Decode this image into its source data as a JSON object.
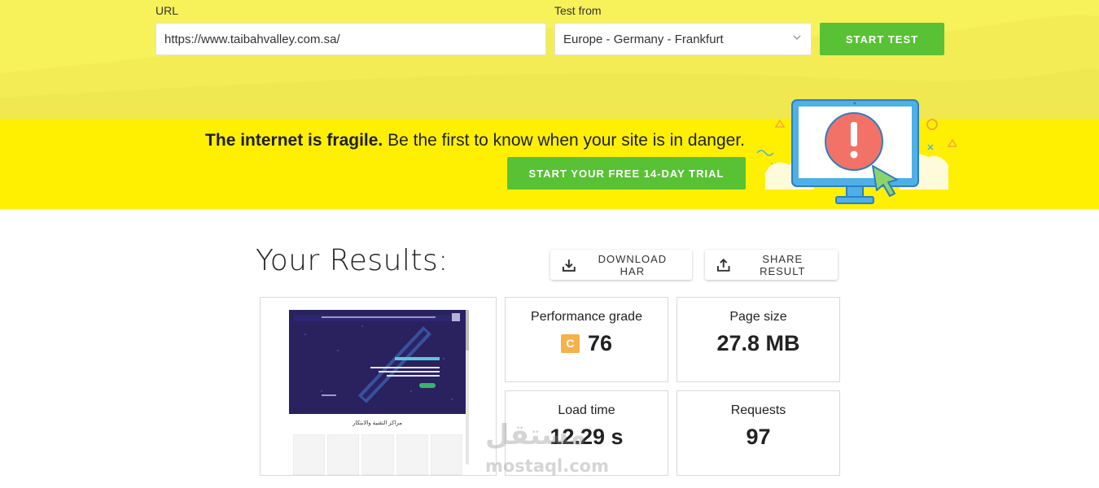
{
  "form": {
    "url_label": "URL",
    "url_value": "https://www.taibahvalley.com.sa/",
    "test_from_label": "Test from",
    "test_from_value": "Europe - Germany - Frankfurt",
    "start_test_label": "START TEST"
  },
  "promo": {
    "bold_text": "The internet is fragile.",
    "text": " Be the first to know when your site is in danger.",
    "trial_button": "START YOUR FREE 14-DAY TRIAL"
  },
  "results": {
    "title": "Your Results:",
    "download_har": "DOWNLOAD HAR",
    "share_result": "SHARE RESULT",
    "site_section_heading": "مراكز التقنية والابتكار",
    "metrics": {
      "performance": {
        "label": "Performance grade",
        "grade": "C",
        "value": "76"
      },
      "page_size": {
        "label": "Page size",
        "value": "27.8 MB"
      },
      "load_time": {
        "label": "Load time",
        "value": "12.29 s"
      },
      "requests": {
        "label": "Requests",
        "value": "97"
      }
    }
  },
  "watermark": {
    "arabic": "مستقل",
    "latin": "mostaql.com"
  },
  "colors": {
    "top_band": "#f7f15a",
    "promo_band": "#fff001",
    "green_button": "#58c234",
    "grade_c": "#f6b24a"
  },
  "icons": [
    "chevron-down-icon",
    "download-icon",
    "share-icon",
    "alert-monitor-illustration"
  ]
}
